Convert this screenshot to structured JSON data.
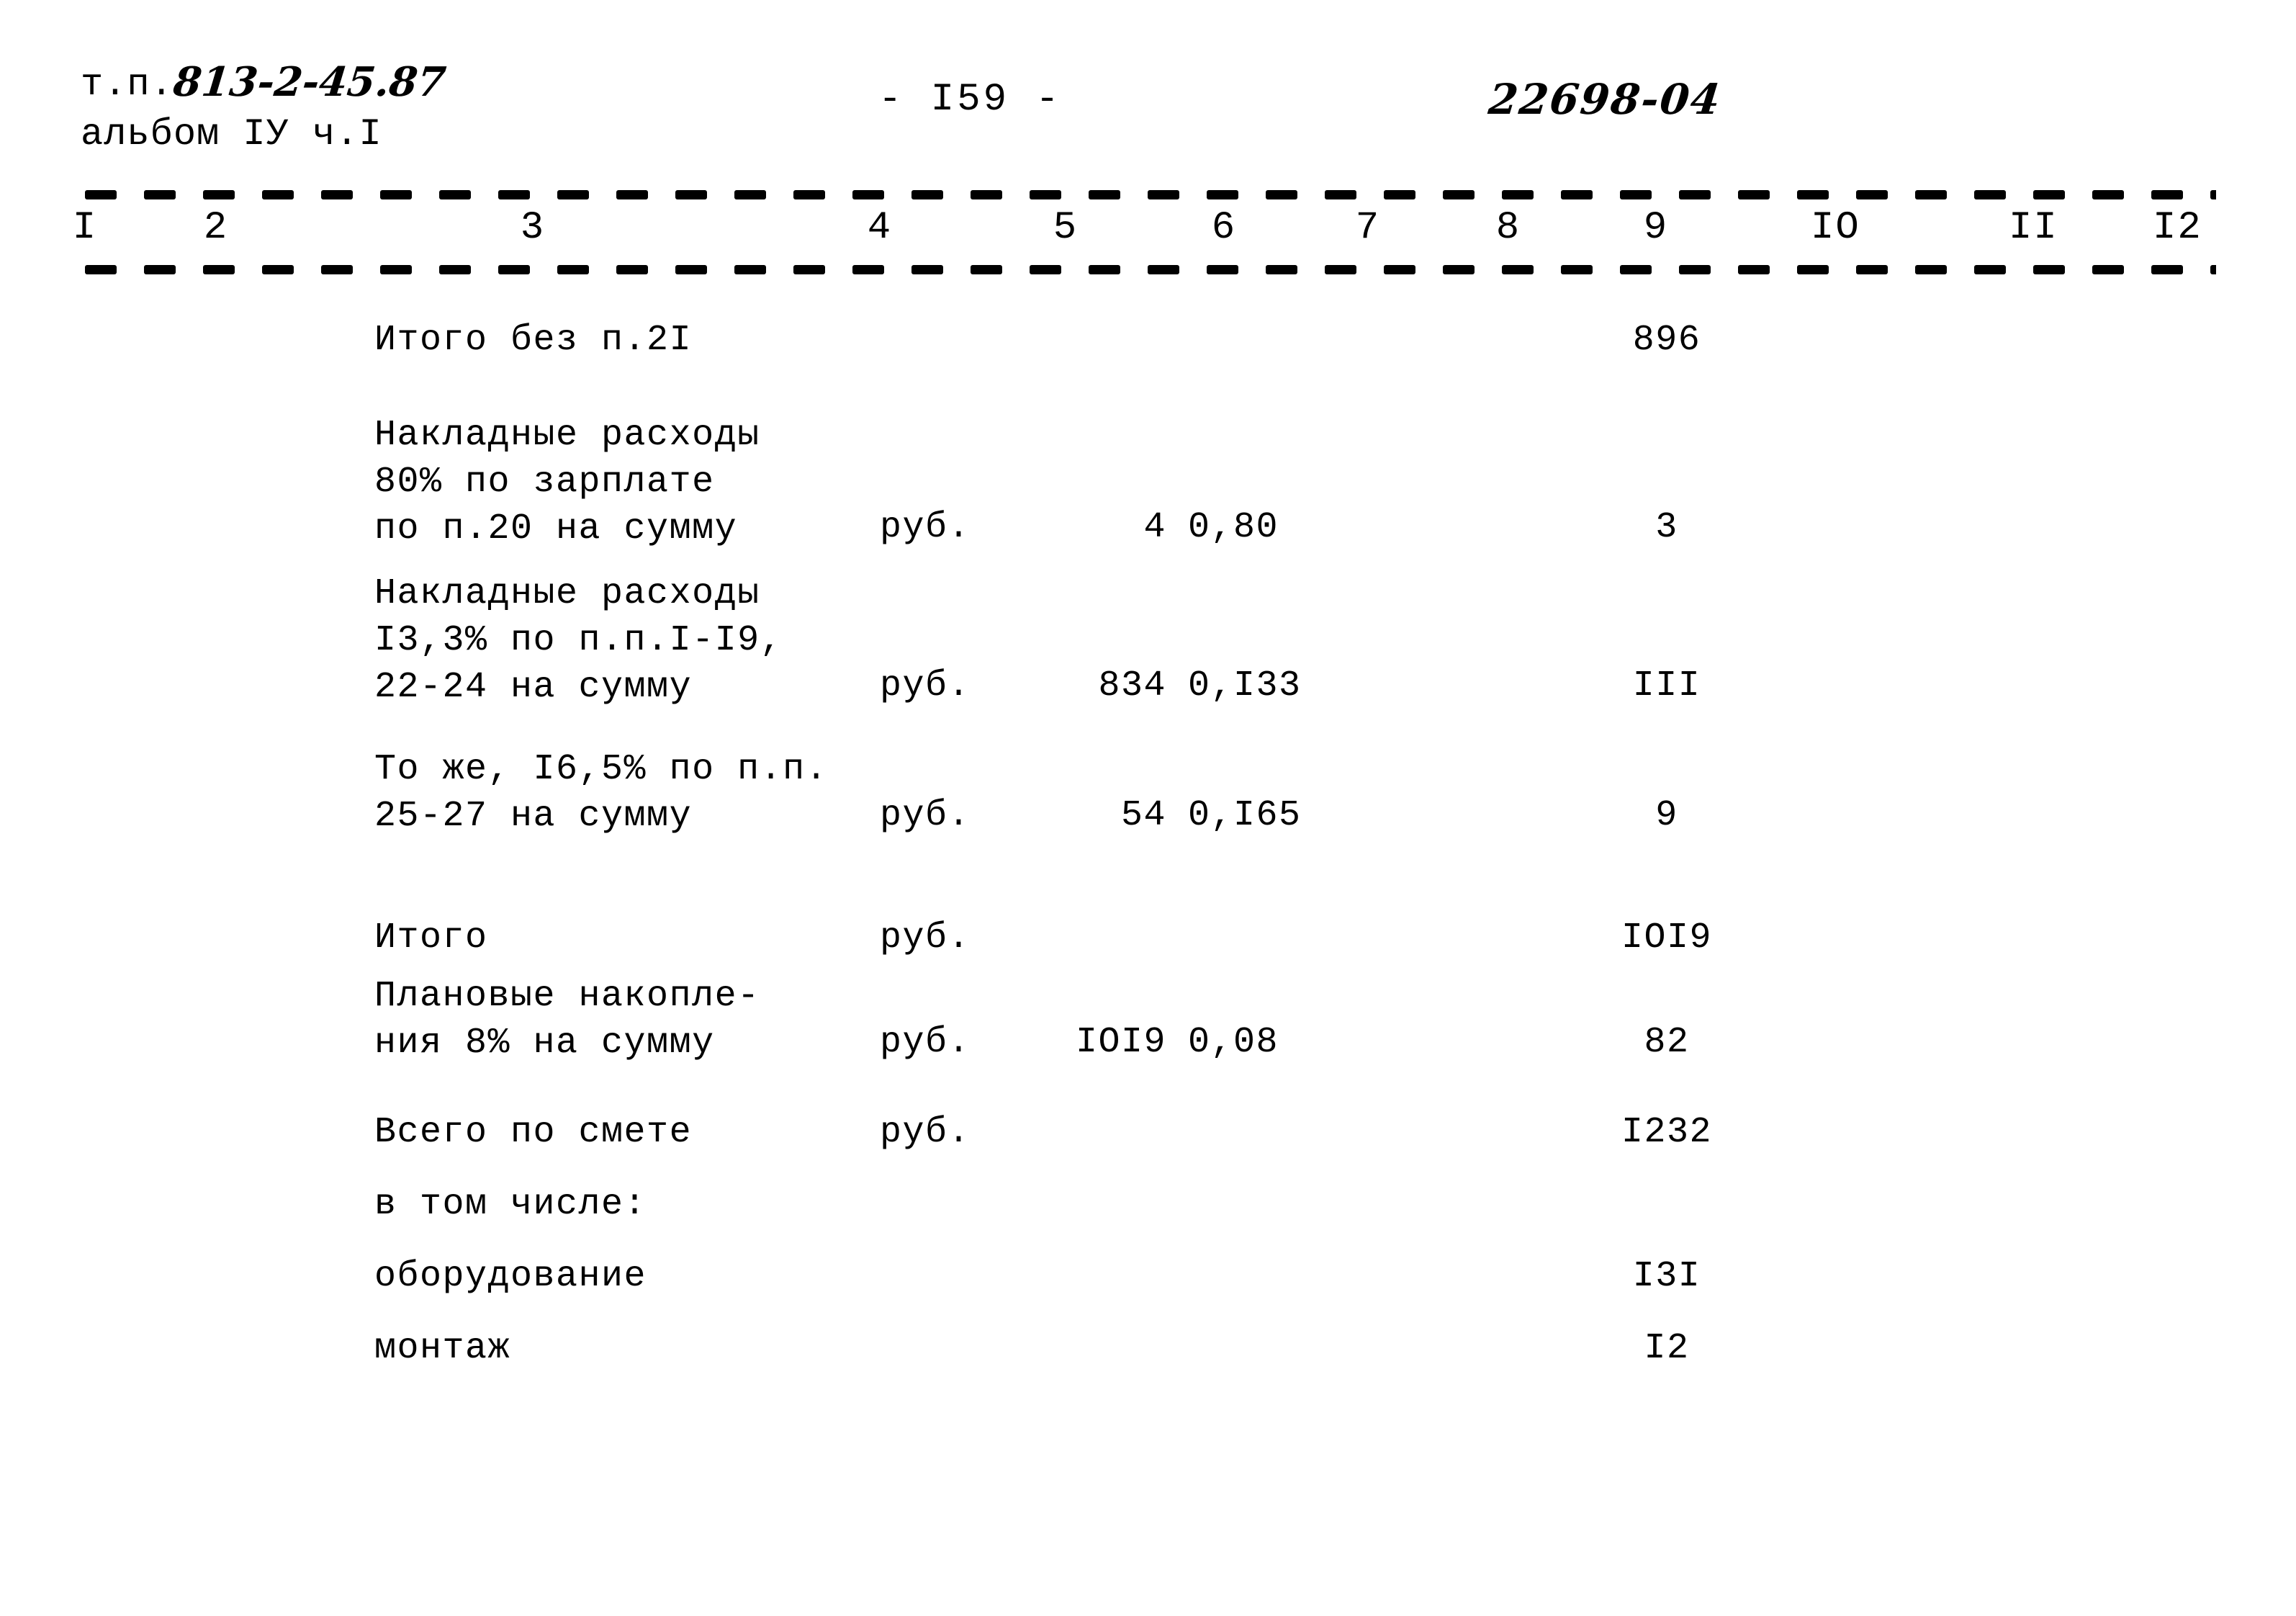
{
  "header": {
    "series_label": "т.п.",
    "series_code": "813-2-45.87",
    "album_line": "альбом IУ ч.I",
    "page_marker": "- I59 -",
    "doc_code": "22698-04"
  },
  "table": {
    "column_numbers": [
      "I",
      "2",
      "3",
      "4",
      "5",
      "6",
      "7",
      "8",
      "9",
      "IO",
      "II",
      "I2"
    ],
    "rows": [
      {
        "description": "Итого без п.2I",
        "unit": "",
        "quantity": "",
        "price": "",
        "sum": "896"
      },
      {
        "description": "Накладные расходы\n80% по зарплате\nпо п.20 на сумму",
        "unit": "руб.",
        "quantity": "4",
        "price": "0,80",
        "sum": "3"
      },
      {
        "description": "Накладные расходы\nI3,3% по п.п.I-I9,\n22-24 на сумму",
        "unit": "руб.",
        "quantity": "834",
        "price": "0,I33",
        "sum": "III"
      },
      {
        "description": "То же, I6,5% по п.п.\n25-27 на сумму",
        "unit": "руб.",
        "quantity": "54",
        "price": "0,I65",
        "sum": "9"
      },
      {
        "description": "Итого",
        "unit": "руб.",
        "quantity": "",
        "price": "",
        "sum": "IOI9"
      },
      {
        "description": "Плановые накопле-\nния 8% на сумму",
        "unit": "руб.",
        "quantity": "IOI9",
        "price": "0,08",
        "sum": "82"
      },
      {
        "description": "Всего по смете",
        "unit": "руб.",
        "quantity": "",
        "price": "",
        "sum": "I232"
      },
      {
        "description": "в том числе:",
        "unit": "",
        "quantity": "",
        "price": "",
        "sum": ""
      },
      {
        "description": "оборудование",
        "unit": "",
        "quantity": "",
        "price": "",
        "sum": "I3I"
      },
      {
        "description": "монтаж",
        "unit": "",
        "quantity": "",
        "price": "",
        "sum": "I2"
      }
    ]
  }
}
